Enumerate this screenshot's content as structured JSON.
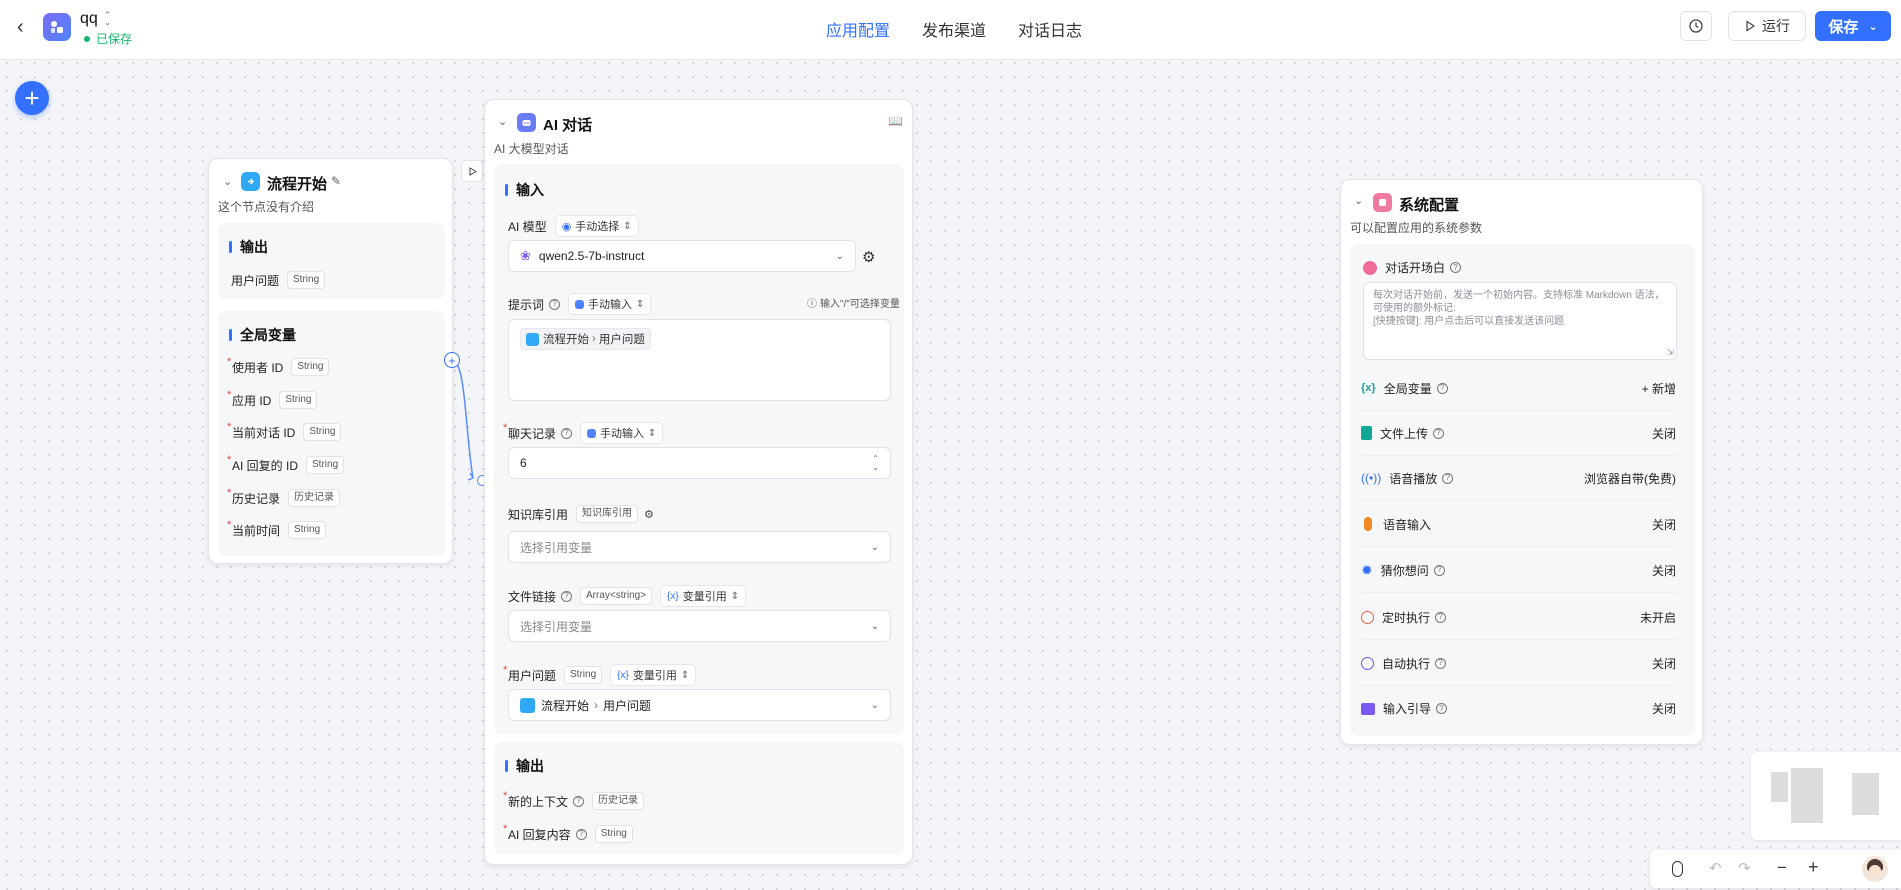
{
  "header": {
    "app_name": "qq",
    "saved_status": "已保存",
    "tabs": [
      "应用配置",
      "发布渠道",
      "对话日志"
    ],
    "run_label": "运行",
    "save_label": "保存"
  },
  "start_node": {
    "title": "流程开始",
    "description": "这个节点没有介绍",
    "output_title": "输出",
    "output_field": {
      "label": "用户问题",
      "type": "String"
    },
    "globals_title": "全局变量",
    "globals": [
      {
        "label": "使用者 ID",
        "type": "String"
      },
      {
        "label": "应用 ID",
        "type": "String"
      },
      {
        "label": "当前对话 ID",
        "type": "String"
      },
      {
        "label": "AI 回复的 ID",
        "type": "String"
      },
      {
        "label": "历史记录",
        "type": "历史记录"
      },
      {
        "label": "当前时间",
        "type": "String"
      }
    ]
  },
  "ai_node": {
    "title": "AI 对话",
    "description": "AI 大模型对话",
    "input_title": "输入",
    "model_label": "AI 模型",
    "model_mode": "手动选择",
    "model_value": "qwen2.5-7b-instruct",
    "prompt_label": "提示词",
    "prompt_mode": "手动输入",
    "prompt_hint": "输入\"/\"可选择变量",
    "prompt_ref_node": "流程开始",
    "prompt_ref_field": "用户问题",
    "history_label": "聊天记录",
    "history_mode": "手动输入",
    "history_value": "6",
    "kb_label": "知识库引用",
    "kb_tag": "知识库引用",
    "kb_placeholder": "选择引用变量",
    "file_label": "文件链接",
    "file_tag": "Array<string>",
    "file_mode": "变量引用",
    "file_placeholder": "选择引用变量",
    "question_label": "用户问题",
    "question_tag": "String",
    "question_mode": "变量引用",
    "question_ref_node": "流程开始",
    "question_ref_field": "用户问题",
    "output_title": "输出",
    "outputs": [
      {
        "label": "新的上下文",
        "type": "历史记录"
      },
      {
        "label": "AI 回复内容",
        "type": "String"
      }
    ]
  },
  "system_node": {
    "title": "系统配置",
    "description": "可以配置应用的系统参数",
    "opening_label": "对话开场白",
    "opening_placeholder_1": "每次对话开始前，发送一个初始内容。支持标准 Markdown 语法，",
    "opening_placeholder_2": "可使用的额外标记:",
    "opening_placeholder_3": "[快捷按键]: 用户点击后可以直接发送该问题",
    "rows": [
      {
        "label": "全局变量",
        "value": "+ 新增",
        "icon": "variable-icon",
        "color": "#17a398"
      },
      {
        "label": "文件上传",
        "value": "关闭",
        "icon": "file-upload-icon",
        "color": "#0fa895"
      },
      {
        "label": "语音播放",
        "value": "浏览器自带(免费)",
        "icon": "broadcast-icon",
        "color": "#3370ff"
      },
      {
        "label": "语音输入",
        "value": "关闭",
        "icon": "microphone-icon",
        "color": "#f08a24"
      },
      {
        "label": "猜你想问",
        "value": "关闭",
        "icon": "lightbulb-icon",
        "color": "#3370ff"
      },
      {
        "label": "定时执行",
        "value": "未开启",
        "icon": "alarm-clock-icon",
        "color": "#e5624d"
      },
      {
        "label": "自动执行",
        "value": "关闭",
        "icon": "auto-run-icon",
        "color": "#6a5cf0"
      },
      {
        "label": "输入引导",
        "value": "关闭",
        "icon": "input-guide-icon",
        "color": "#7a5af0"
      }
    ]
  },
  "colors": {
    "accent": "#3370ff",
    "saved_green": "#12b76a"
  }
}
